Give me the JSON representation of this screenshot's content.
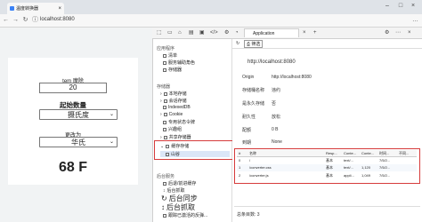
{
  "browser": {
    "tab_title": "温度转换器",
    "address": "localhost:8080",
    "address_icon": "info-icon"
  },
  "page": {
    "term_label": "tem 摩除",
    "temp_value": "20",
    "start_label": "起始数量",
    "from_unit": "摄氏度",
    "convert_label": "更改为",
    "to_unit": "华氏",
    "result": "68 F"
  },
  "devtools": {
    "tabs": [
      "Application"
    ],
    "filter_label": "筛选",
    "sidebar": {
      "section_app": "应用程序",
      "app_items": [
        "清单",
        "服务辅助角色",
        "存储器"
      ],
      "section_storage": "存储器",
      "storage_items": [
        "本地存储",
        "会话存储",
        "IndexedDB",
        "Cookie",
        "专用状态令牌",
        "兴趣组",
        "共享存储器",
        "缓存存储",
        "山谷"
      ],
      "section_bg": "后台服务",
      "bg_items": [
        "后退/前进缓存",
        "后台抓取",
        "后台同步",
        "跟踪已激活的反弹..."
      ],
      "bg_big_1": "后台抓取",
      "bg_big_2": "后台同步"
    },
    "details": {
      "header_url": "http://localhost:8080",
      "origin_label": "Origin",
      "origin_value": "http://localhost:8080",
      "bucket_label": "存储桶名称",
      "bucket_value": "违约",
      "persistent_label": "是永久存储",
      "persistent_value": "否",
      "durability_label": "耐久性",
      "durability_value": "放松",
      "quota_label": "配额",
      "quota_value": "0 B",
      "expiry_label": "到期",
      "expiry_value": "None"
    },
    "table": {
      "headers": [
        "#",
        "名称",
        "Resp...",
        "Conte...",
        "Conte...",
        "时间...",
        "不同..."
      ],
      "rows": [
        {
          "num": "0",
          "name": "/",
          "resp": "基本",
          "ctype": "text/...",
          "clen": "",
          "time": "7/5/2...",
          "vary": ""
        },
        {
          "num": "1",
          "name": "/converter.css",
          "resp": "基本",
          "ctype": "text/...",
          "clen": "1,120",
          "time": "7/5/2...",
          "vary": ""
        },
        {
          "num": "2",
          "name": "/converter.js",
          "resp": "基本",
          "ctype": "appli...",
          "clen": "1,049",
          "time": "7/5/2...",
          "vary": ""
        }
      ],
      "footer": "总条目数: 3"
    }
  }
}
